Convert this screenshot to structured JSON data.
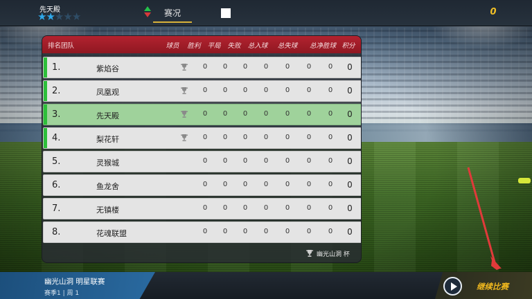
{
  "header": {
    "club_name": "先天殿",
    "rating": {
      "value": 2,
      "max": 5
    },
    "tab_title": "赛况",
    "currency": "0"
  },
  "table": {
    "columns": {
      "pos_team": "排名团队",
      "player": "球员",
      "wins": "胜利",
      "draws": "平局",
      "losses": "失败",
      "goals_for": "总入球",
      "goals_against": "总失球",
      "goal_diff": "总净胜球",
      "points": "积分"
    },
    "rows": [
      {
        "rank": "1.",
        "team": "紫焰谷",
        "trophy": true,
        "highlight": false,
        "accent": true,
        "wins": "0",
        "draws": "0",
        "losses": "0",
        "gf": "0",
        "ga": "0",
        "gd": "0",
        "pts": "0"
      },
      {
        "rank": "2.",
        "team": "凤凰观",
        "trophy": true,
        "highlight": false,
        "accent": true,
        "wins": "0",
        "draws": "0",
        "losses": "0",
        "gf": "0",
        "ga": "0",
        "gd": "0",
        "pts": "0"
      },
      {
        "rank": "3.",
        "team": "先天殿",
        "trophy": true,
        "highlight": true,
        "accent": true,
        "wins": "0",
        "draws": "0",
        "losses": "0",
        "gf": "0",
        "ga": "0",
        "gd": "0",
        "pts": "0"
      },
      {
        "rank": "4.",
        "team": "梨花轩",
        "trophy": true,
        "highlight": false,
        "accent": true,
        "wins": "0",
        "draws": "0",
        "losses": "0",
        "gf": "0",
        "ga": "0",
        "gd": "0",
        "pts": "0"
      },
      {
        "rank": "5.",
        "team": "灵猴城",
        "trophy": false,
        "highlight": false,
        "accent": false,
        "wins": "0",
        "draws": "0",
        "losses": "0",
        "gf": "0",
        "ga": "0",
        "gd": "0",
        "pts": "0"
      },
      {
        "rank": "6.",
        "team": "鱼龙舍",
        "trophy": false,
        "highlight": false,
        "accent": false,
        "wins": "0",
        "draws": "0",
        "losses": "0",
        "gf": "0",
        "ga": "0",
        "gd": "0",
        "pts": "0"
      },
      {
        "rank": "7.",
        "team": "无镇楼",
        "trophy": false,
        "highlight": false,
        "accent": false,
        "wins": "0",
        "draws": "0",
        "losses": "0",
        "gf": "0",
        "ga": "0",
        "gd": "0",
        "pts": "0"
      },
      {
        "rank": "8.",
        "team": "花魂联盟",
        "trophy": false,
        "highlight": false,
        "accent": false,
        "wins": "0",
        "draws": "0",
        "losses": "0",
        "gf": "0",
        "ga": "0",
        "gd": "0",
        "pts": "0"
      }
    ],
    "footer_cup": "幽光山洞 杯"
  },
  "footer": {
    "league_name": "幽光山洞 明星联赛",
    "season_line": "赛季1 | 周 1",
    "continue_label": "继续比赛"
  },
  "colors": {
    "header_red": "#b3222f",
    "highlight_green": "#9fd29b",
    "accent_green": "#2dbf3a",
    "star_blue": "#2fa8ea",
    "gold": "#f0b81e"
  }
}
